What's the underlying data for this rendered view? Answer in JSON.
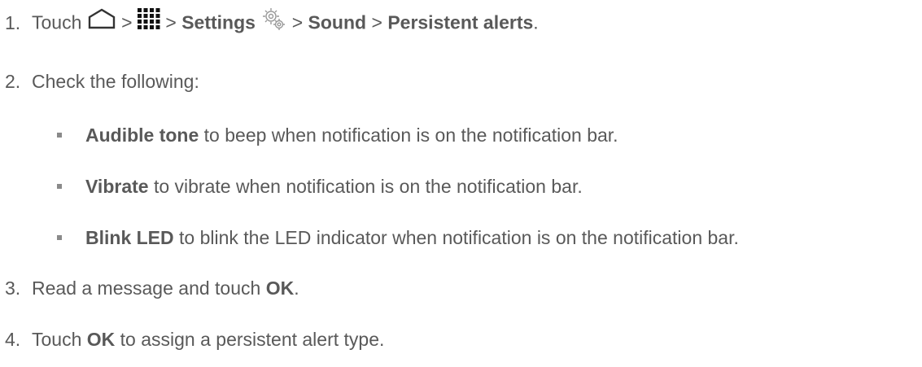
{
  "steps": [
    {
      "number": "1.",
      "parts": {
        "touch": "Touch",
        "sep1": ">",
        "sep2": ">",
        "settings": "Settings",
        "sep3": ">",
        "sound": "Sound",
        "sep4": ">",
        "persistent_alerts": "Persistent alerts",
        "end": "."
      },
      "icons": [
        "home-icon",
        "apps-grid-icon",
        "settings-gear-icon"
      ]
    },
    {
      "number": "2.",
      "text": "Check the following:"
    },
    {
      "number": "3.",
      "parts": {
        "text": "Read a message and touch",
        "ok": "OK",
        "end": "."
      }
    },
    {
      "number": "4.",
      "parts": {
        "touch": "Touch",
        "ok": "OK",
        "text": "to assign a persistent alert type."
      }
    }
  ],
  "bullets": [
    {
      "term": "Audible tone",
      "text": "to beep when notification is on the notification bar."
    },
    {
      "term": "Vibrate",
      "text": "to vibrate when notification is on the notification bar."
    },
    {
      "term": "Blink LED",
      "text": "to blink the LED indicator when notification is on the notification bar."
    }
  ]
}
